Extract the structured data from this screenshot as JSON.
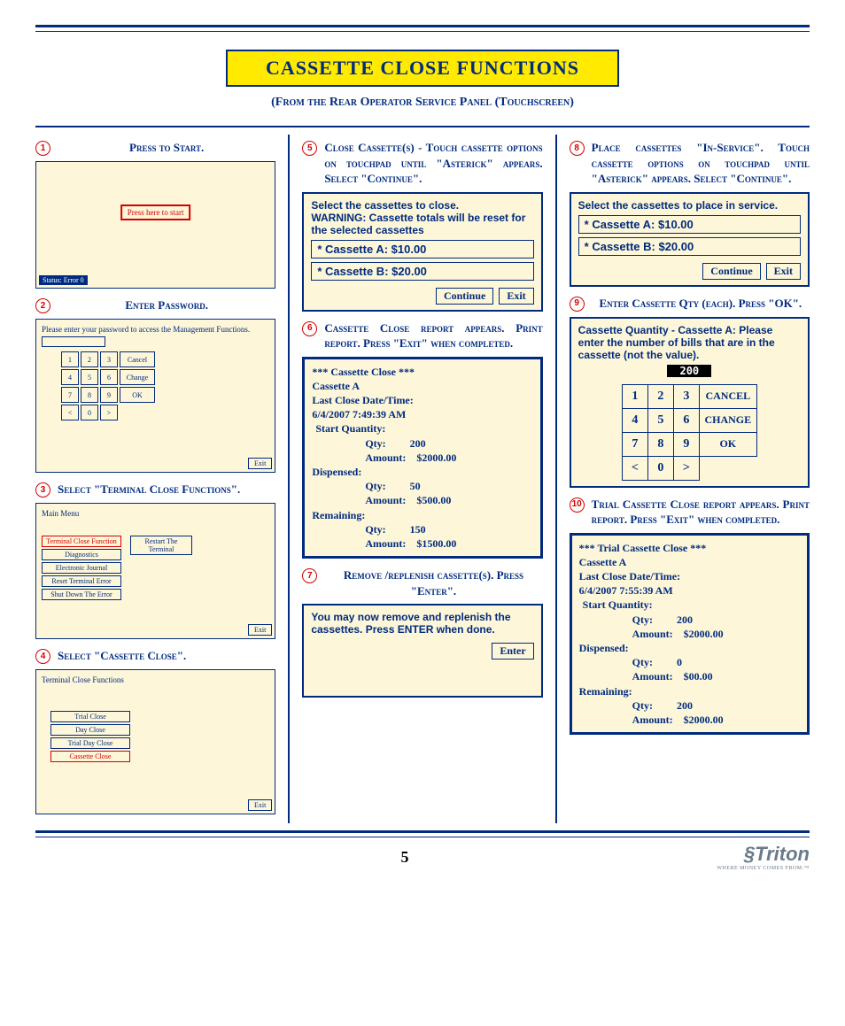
{
  "title": "CASSETTE CLOSE FUNCTIONS",
  "subtitle": "(From the Rear Operator Service Panel (Touchscreen)",
  "page_number": "5",
  "logo": "Triton",
  "logo_tag": "WHERE MONEY COMES FROM.™",
  "steps": {
    "s1": {
      "num": "1",
      "txt": "Press to Start."
    },
    "s2": {
      "num": "2",
      "txt": "Enter Password."
    },
    "s3": {
      "num": "3",
      "txt": "Select \"Terminal Close Functions\"."
    },
    "s4": {
      "num": "4",
      "txt": "Select \"Cassette Close\"."
    },
    "s5": {
      "num": "5",
      "txt": "Close Cassette(s) - Touch cassette options on touchpad until \"Asterick\" appears. Select \"Continue\"."
    },
    "s6": {
      "num": "6",
      "txt": "Cassette Close report appears. Print report. Press \"Exit\" when completed."
    },
    "s7": {
      "num": "7",
      "txt": "Remove /replenish cassette(s). Press \"Enter\"."
    },
    "s8": {
      "num": "8",
      "txt": "Place cassettes \"In-Service\". Touch cassette options on touchpad until \"Asterick\" appears. Select \"Continue\"."
    },
    "s9": {
      "num": "9",
      "txt": "Enter Cassette Qty (each). Press \"OK\"."
    },
    "s10": {
      "num": "10",
      "txt": "Trial Cassette Close report appears. Print report. Press \"Exit\" when completed."
    }
  },
  "shot1": {
    "press": "Press here to start",
    "status": "Status: Error 0"
  },
  "shot2": {
    "msg": "Please enter your password to access the Management Functions.",
    "k": [
      "1",
      "2",
      "3",
      "Cancel",
      "4",
      "5",
      "6",
      "Change",
      "7",
      "8",
      "9",
      "OK",
      "<",
      "0",
      ">"
    ],
    "exit": "Exit"
  },
  "shot3": {
    "title": "Main Menu",
    "items": [
      "Terminal Close Function",
      "Diagnostics",
      "Electronic Journal",
      "Reset Terminal Error",
      "Shut Down The Error"
    ],
    "right": "Restart The Terminal",
    "exit": "Exit"
  },
  "shot4": {
    "title": "Terminal Close Functions",
    "items": [
      "Trial Close",
      "Day Close",
      "Trial Day Close",
      "Cassette Close"
    ],
    "exit": "Exit"
  },
  "panel5": {
    "msg1": "Select the cassettes to close.",
    "msg2": "WARNING:  Cassette totals will be reset for the selected cassettes",
    "a": "* Cassette A:   $10.00",
    "b": "* Cassette B:   $20.00",
    "continue": "Continue",
    "exit": "Exit"
  },
  "report6": {
    "title": "*** Cassette Close ***",
    "name": "Cassette A",
    "dtlabel": "Last Close Date/Time:",
    "dt": "6/4/2007  7:49:39 AM",
    "start": "Start Quantity:",
    "sq": "Qty:         200",
    "sa": "Amount:    $2000.00",
    "disp": "Dispensed:",
    "dq": "Qty:         50",
    "da": "Amount:    $500.00",
    "rem": "Remaining:",
    "rq": "Qty:         150",
    "ra": "Amount:    $1500.00"
  },
  "panel7": {
    "msg": "You may now remove and replenish the cassettes.  Press ENTER when done.",
    "enter": "Enter"
  },
  "panel8": {
    "msg": "Select the cassettes to place in service.",
    "a": "* Cassette A:   $10.00",
    "b": "* Cassette B:   $20.00",
    "continue": "Continue",
    "exit": "Exit"
  },
  "panel9": {
    "msg": "Cassette Quantity - Cassette A: Please enter the number of bills that are in the cassette (not the value).",
    "value": "200",
    "k": [
      "1",
      "2",
      "3",
      "CANCEL",
      "4",
      "5",
      "6",
      "CHANGE",
      "7",
      "8",
      "9",
      "OK",
      "<",
      "0",
      ">"
    ]
  },
  "report10": {
    "title": "*** Trial Cassette Close ***",
    "name": "Cassette A",
    "dtlabel": "Last Close Date/Time:",
    "dt": "6/4/2007  7:55:39 AM",
    "start": "Start Quantity:",
    "sq": "Qty:         200",
    "sa": "Amount:    $2000.00",
    "disp": "Dispensed:",
    "dq": "Qty:         0",
    "da": "Amount:    $00.00",
    "rem": "Remaining:",
    "rq": "Qty:         200",
    "ra": "Amount:    $2000.00"
  }
}
